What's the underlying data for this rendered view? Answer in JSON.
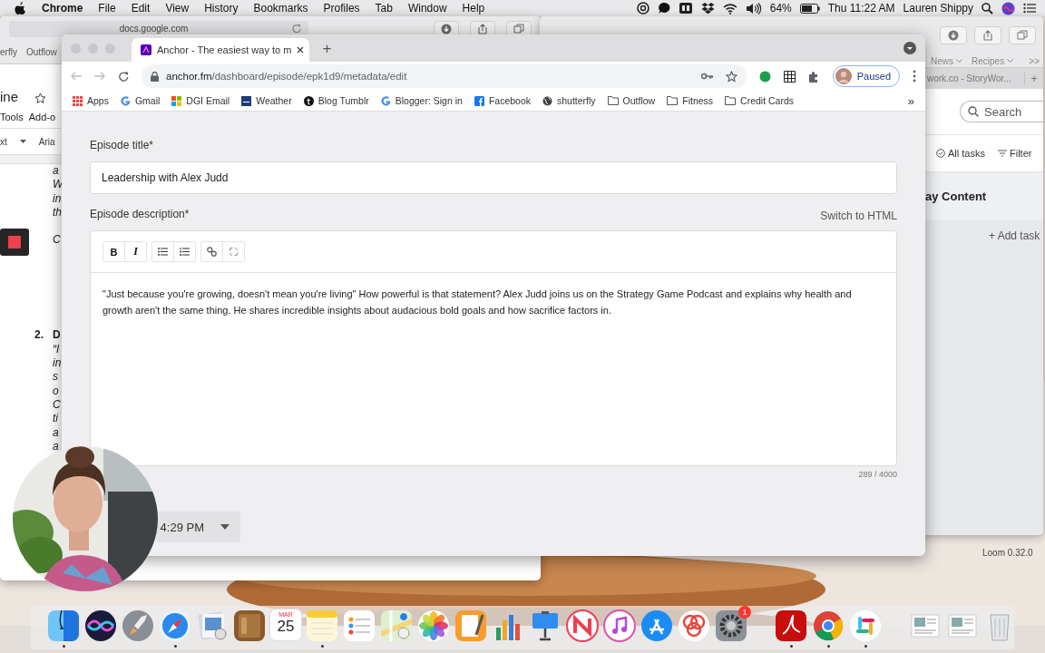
{
  "menu_bar": {
    "app": "Chrome",
    "menus": [
      "File",
      "Edit",
      "View",
      "History",
      "Bookmarks",
      "Profiles",
      "Tab",
      "Window",
      "Help"
    ],
    "battery": "64%",
    "clock": "Thu 11:22 AM",
    "user": "Lauren Shippy"
  },
  "docs_window": {
    "url": "docs.google.com",
    "bookmarks": [
      "erfly",
      "Outflow"
    ],
    "doc_title": "ine",
    "menus": [
      "Tools",
      "Add-o"
    ],
    "toolbar": [
      "xt",
      "Aria"
    ],
    "lines_top": [
      "a",
      "W",
      "in",
      "th"
    ],
    "line_after": "C",
    "list_number": "2.",
    "list_lines": [
      "D",
      "“I",
      "in",
      "s",
      "o",
      "C",
      "ti",
      "a",
      "a"
    ]
  },
  "safari_window": {
    "bookmarks": [
      "News",
      "Recipes"
    ],
    "more": ">>",
    "tab": "work.co - StoryWor...",
    "new_tab": "+",
    "search": {
      "placeholder": "Search"
    },
    "filters": [
      "All tasks",
      "Filter"
    ],
    "section_title": "ay Content",
    "add_task": "+ Add task"
  },
  "chrome_window": {
    "tab_title": "Anchor - The easiest way to m",
    "new_tab": "+",
    "url_host": "anchor.fm",
    "url_path": "/dashboard/episode/epk1d9/metadata/edit",
    "profile_status": "Paused",
    "bookmarks": [
      {
        "kind": "apps",
        "label": "Apps"
      },
      {
        "kind": "google",
        "label": "Gmail"
      },
      {
        "kind": "tiles",
        "label": "DGI Email"
      },
      {
        "kind": "square",
        "label": "Weather"
      },
      {
        "kind": "tumblr",
        "label": "Blog Tumblr"
      },
      {
        "kind": "google",
        "label": "Blogger: Sign in"
      },
      {
        "kind": "facebook",
        "label": "Facebook"
      },
      {
        "kind": "globe",
        "label": "shutterfly"
      },
      {
        "kind": "folder",
        "label": "Outflow"
      },
      {
        "kind": "folder",
        "label": "Fitness"
      },
      {
        "kind": "folder",
        "label": "Credit Cards"
      }
    ],
    "bookmarks_more": "»",
    "page": {
      "title_label": "Episode title*",
      "title_value": "Leadership with Alex Judd",
      "description_label": "Episode description*",
      "switch_link": "Switch to HTML",
      "format_groups": [
        [
          {
            "kind": "text",
            "label": "B"
          },
          {
            "kind": "text",
            "label": "I"
          }
        ],
        [
          {
            "kind": "bullets"
          },
          {
            "kind": "numbers"
          }
        ],
        [
          {
            "kind": "link"
          },
          {
            "kind": "unlink"
          }
        ]
      ],
      "description": "\"Just because you're growing, doesn't mean you're living\" How powerful is that statement? Alex Judd joins us on the Strategy Game Podcast and explains why health and growth aren't the same thing. He shares incredible insights about audacious bold goals and how sacrifice factors in.",
      "counter": "289 / 4000",
      "schedule_value": "4:29 PM"
    }
  },
  "loom_label": "Loom 0.32.0",
  "dock": [
    {
      "kind": "finder",
      "running": true
    },
    {
      "kind": "siri",
      "running": false
    },
    {
      "kind": "rocket",
      "running": false
    },
    {
      "kind": "compass",
      "running": true
    },
    {
      "kind": "preview",
      "running": false
    },
    {
      "kind": "book",
      "running": false
    },
    {
      "kind": "calendar",
      "month": "MAR",
      "day": "25",
      "running": false
    },
    {
      "kind": "notes",
      "running": true
    },
    {
      "kind": "reminders",
      "running": false
    },
    {
      "kind": "maps",
      "running": false
    },
    {
      "kind": "photos",
      "running": false
    },
    {
      "kind": "pages",
      "running": false
    },
    {
      "kind": "numbers",
      "running": false
    },
    {
      "kind": "keynote",
      "running": false
    },
    {
      "kind": "news",
      "running": false
    },
    {
      "kind": "music",
      "running": false
    },
    {
      "kind": "appstore",
      "running": false
    },
    {
      "kind": "swirl",
      "running": false
    },
    {
      "kind": "settings",
      "badge": "1",
      "running": false
    },
    {
      "kind": "divider"
    },
    {
      "kind": "pdf",
      "running": true
    },
    {
      "kind": "chrome",
      "running": true
    },
    {
      "kind": "slack",
      "running": true
    },
    {
      "kind": "divider"
    },
    {
      "kind": "thumb",
      "running": false
    },
    {
      "kind": "thumb",
      "running": false
    },
    {
      "kind": "trash",
      "running": false
    }
  ]
}
